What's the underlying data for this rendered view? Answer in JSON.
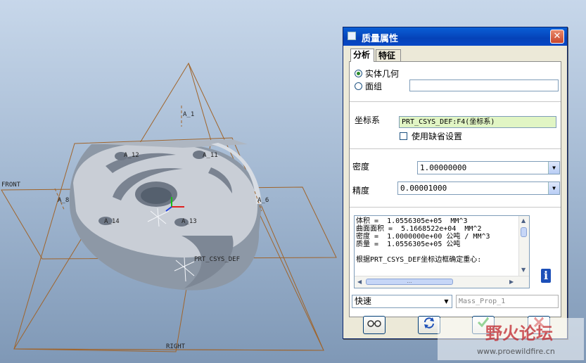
{
  "viewport": {
    "datum_labels": {
      "front": "FRONT",
      "right": "RIGHT",
      "a1": "A_1",
      "a12": "A_12",
      "a11": "A_11",
      "a8": "A_8",
      "a6": "A_6",
      "a14": "A_14",
      "a13": "A_13",
      "csys": "PRT_CSYS_DEF"
    }
  },
  "dialog": {
    "title": "质量属性",
    "close_label": "✕",
    "tabs": [
      "分析",
      "特征"
    ],
    "source_options": {
      "solid": "实体几何",
      "quilt": "面组"
    },
    "quilt_value": "",
    "csys_label": "坐标系",
    "csys_value": "PRT_CSYS_DEF:F4(坐标系)",
    "use_default_label": "使用缺省设置",
    "density_label": "密度",
    "density_value": "1.00000000",
    "accuracy_label": "精度",
    "accuracy_value": "0.00001000",
    "results": [
      "体积 =  1.0556305e+05  MM^3",
      "曲面面积 =  5.1668522e+04  MM^2",
      "密度 =  1.0000000e+00 公吨 / MM^3",
      "质量 =  1.0556305e+05 公吨",
      "",
      "根据PRT_CSYS_DEF坐标边框确定重心:"
    ],
    "mode_value": "快速",
    "name_placeholder": "Mass_Prop_1"
  },
  "watermark": {
    "title": "野火论坛",
    "url": "www.proewildfire.cn"
  },
  "colors": {
    "datum_plane": "#a0642a",
    "title_bar": "#0a5fd6",
    "csys_field": "#e1f5c4"
  }
}
